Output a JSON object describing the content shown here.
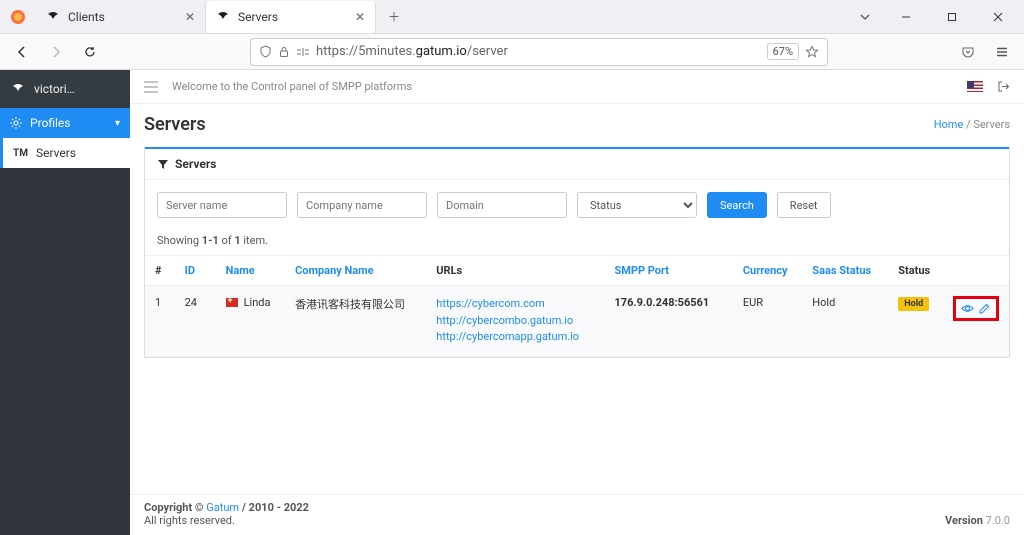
{
  "browser": {
    "tabs": [
      {
        "title": "Clients",
        "active": false
      },
      {
        "title": "Servers",
        "active": true
      }
    ],
    "url_prefix": "https://5minutes.",
    "url_domain": "gatum.io",
    "url_path": "/server",
    "zoom": "67%"
  },
  "sidebar": {
    "user": "victori…",
    "items": [
      {
        "label": "Profiles"
      },
      {
        "prefix": "TM",
        "label": "Servers"
      }
    ]
  },
  "mainbar": {
    "welcome": "Welcome to the Control panel of SMPP platforms"
  },
  "header": {
    "title": "Servers",
    "breadcrumb_home": "Home",
    "breadcrumb_current": "Servers"
  },
  "panel": {
    "title": "Servers",
    "filters": {
      "server_ph": "Server name",
      "company_ph": "Company name",
      "domain_ph": "Domain",
      "status_label": "Status",
      "search": "Search",
      "reset": "Reset"
    },
    "showing": {
      "pre": "Showing ",
      "range": "1-1",
      "mid": " of ",
      "total": "1",
      "post": " item."
    },
    "columns": {
      "num": "#",
      "id": "ID",
      "name": "Name",
      "company": "Company Name",
      "urls": "URLs",
      "smpp": "SMPP Port",
      "currency": "Currency",
      "saas": "Saas Status",
      "status": "Status"
    },
    "rows": [
      {
        "num": "1",
        "id": "24",
        "name": "Linda",
        "company": "香港讯客科技有限公司",
        "urls": [
          "https://cybercom.com",
          "http://cybercombo.gatum.io",
          "http://cybercomapp.gatum.io"
        ],
        "smpp": "176.9.0.248:56561",
        "currency": "EUR",
        "saas": "Hold",
        "status": "Hold"
      }
    ]
  },
  "footer": {
    "copyright_pre": "Copyright © ",
    "brand": "Gatum",
    "copyright_post": " / 2010 - 2022",
    "rights": "All rights reserved.",
    "version_label": "Version ",
    "version": "7.0.0"
  }
}
